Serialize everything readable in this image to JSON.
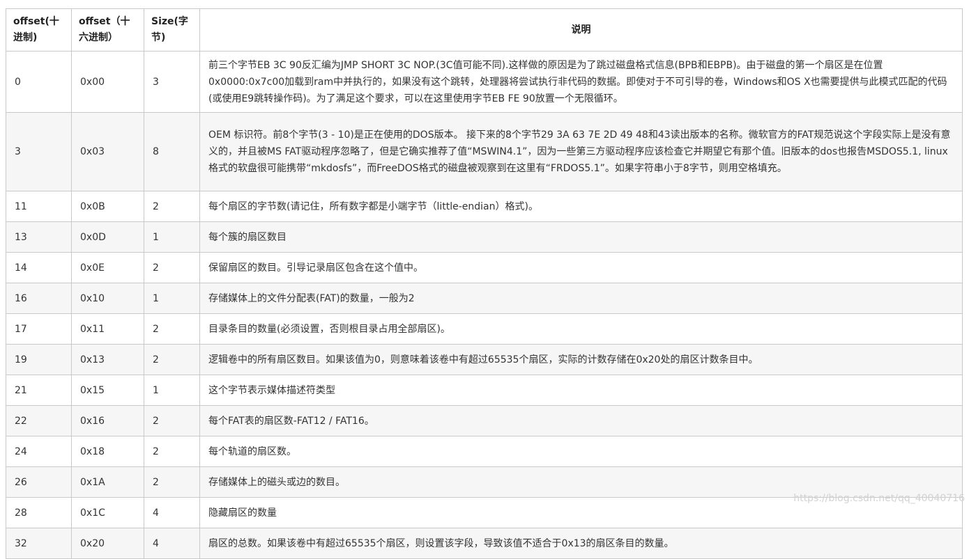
{
  "headers": {
    "offset_dec": "offset(十进制)",
    "offset_hex": "offset（十六进制）",
    "size": "Size(字节)",
    "description": "说明"
  },
  "rows": [
    {
      "dec": "0",
      "hex": "0x00",
      "size": "3",
      "desc": "前三个字节EB 3C 90反汇编为JMP SHORT 3C NOP.(3C值可能不同).这样做的原因是为了跳过磁盘格式信息(BPB和EBPB)。由于磁盘的第一个扇区是在位置0x0000:0x7c00加载到ram中并执行的，如果没有这个跳转，处理器将尝试执行非代码的数据。即使对于不可引导的卷，Windows和OS X也需要提供与此模式匹配的代码(或使用E9跳转操作码)。为了满足这个要求，可以在这里使用字节EB FE 90放置一个无限循环。"
    },
    {
      "dec": "3",
      "hex": "0x03",
      "size": "8",
      "desc": "OEM 标识符。前8个字节(3 - 10)是正在使用的DOS版本。 接下来的8个字节29 3A 63 7E 2D 49 48和43读出版本的名称。微软官方的FAT规范说这个字段实际上是没有意义的，并且被MS FAT驱动程序忽略了，但是它确实推荐了值“MSWIN4.1”，因为一些第三方驱动程序应该检查它并期望它有那个值。旧版本的dos也报告MSDOS5.1, linux格式的软盘很可能携带“mkdosfs”，而FreeDOS格式的磁盘被观察到在这里有“FRDOS5.1”。如果字符串小于8字节，则用空格填充。"
    },
    {
      "dec": "11",
      "hex": "0x0B",
      "size": "2",
      "desc": "每个扇区的字节数(请记住，所有数字都是小端字节（little-endian）格式)。"
    },
    {
      "dec": "13",
      "hex": "0x0D",
      "size": "1",
      "desc": "每个簇的扇区数目"
    },
    {
      "dec": "14",
      "hex": "0x0E",
      "size": "2",
      "desc": "保留扇区的数目。引导记录扇区包含在这个值中。"
    },
    {
      "dec": "16",
      "hex": "0x10",
      "size": "1",
      "desc": "存储媒体上的文件分配表(FAT)的数量，一般为2"
    },
    {
      "dec": "17",
      "hex": "0x11",
      "size": "2",
      "desc": "目录条目的数量(必须设置，否则根目录占用全部扇区)。"
    },
    {
      "dec": "19",
      "hex": "0x13",
      "size": "2",
      "desc": "逻辑卷中的所有扇区数目。如果该值为0，则意味着该卷中有超过65535个扇区，实际的计数存储在0x20处的扇区计数条目中。"
    },
    {
      "dec": "21",
      "hex": "0x15",
      "size": "1",
      "desc": "这个字节表示媒体描述符类型"
    },
    {
      "dec": "22",
      "hex": "0x16",
      "size": "2",
      "desc": "每个FAT表的扇区数-FAT12 / FAT16。"
    },
    {
      "dec": "24",
      "hex": "0x18",
      "size": "2",
      "desc": "每个轨道的扇区数。"
    },
    {
      "dec": "26",
      "hex": "0x1A",
      "size": "2",
      "desc": "存储媒体上的磁头或边的数目。"
    },
    {
      "dec": "28",
      "hex": "0x1C",
      "size": "4",
      "desc": "隐藏扇区的数量"
    },
    {
      "dec": "32",
      "hex": "0x20",
      "size": "4",
      "desc": "扇区的总数。如果该卷中有超过65535个扇区，则设置该字段，导致该值不适合于0x13的扇区条目的数量。"
    }
  ],
  "watermark": "https://blog.csdn.net/qq_40040716"
}
